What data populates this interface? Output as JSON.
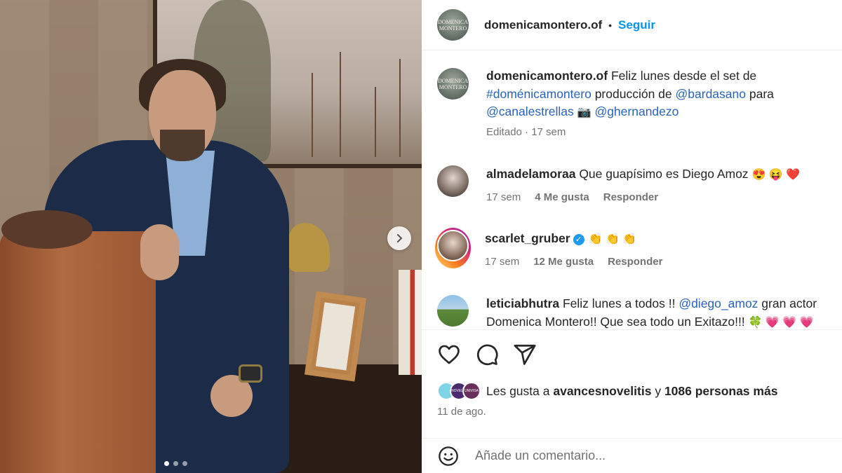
{
  "post": {
    "image_alt": "Actor in navy suit sitting on leather chair in front of a painting",
    "carousel": {
      "total_slides": 3,
      "active_slide": 1
    }
  },
  "header": {
    "avatar_text": "DOMENICA MONTERO",
    "username": "domenicamontero.of",
    "separator": "•",
    "follow_label": "Seguir"
  },
  "caption": {
    "username": "domenicamontero.of",
    "line1_text": "Feliz lunes desde el set de",
    "hashtag": "#doménicamontero",
    "line2_text": "producción de",
    "mention1": "@bardasano",
    "line2_end": "para",
    "mention2": "@canalestrellas",
    "camera_emoji": "📷",
    "mention3": "@ghernandezo",
    "meta": "Editado · 17 sem"
  },
  "comments": [
    {
      "username": "almadelamoraa",
      "text": "Que guapísimo es Diego Amoz",
      "emojis": "😍 😝 ❤️",
      "time": "17 sem",
      "likes": "4 Me gusta",
      "reply": "Responder"
    },
    {
      "username": "scarlet_gruber",
      "verified": "✓",
      "text": "",
      "emojis": "👏 👏 👏",
      "time": "17 sem",
      "likes": "12 Me gusta",
      "reply": "Responder"
    },
    {
      "username": "leticiabhutra",
      "text_part1": "Feliz lunes a todos !!",
      "mention": "@diego_amoz",
      "text_part2": "gran actor",
      "line2": "Domenica Montero!! Que sea todo un Exitazo!!!",
      "emojis": "🍀 💗 💗 💗"
    }
  ],
  "actions": {
    "like_icon": "heart-icon",
    "comment_icon": "comment-icon",
    "share_icon": "share-icon"
  },
  "likes": {
    "prefix": "Les gusta a",
    "user": "avancesnovelitis",
    "connector": "y",
    "others": "1086 personas más",
    "avatar_labels": [
      "",
      "NOVELAS",
      "UNIVISA"
    ]
  },
  "date": "11 de ago.",
  "add_comment": {
    "emoji_icon": "smile-icon",
    "placeholder": "Añade un comentario..."
  },
  "colors": {
    "link": "#2b63b7",
    "follow": "#0095f6",
    "muted": "#737373",
    "text": "#262626"
  }
}
